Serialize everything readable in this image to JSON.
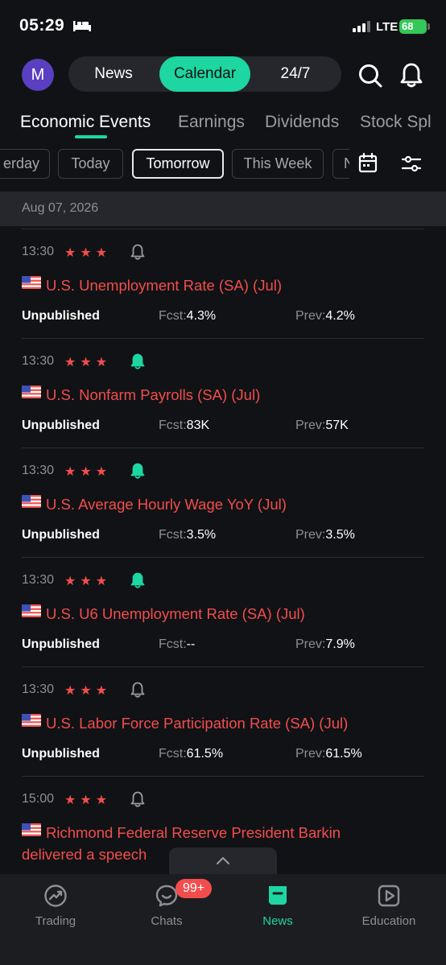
{
  "status_bar": {
    "time": "05:29",
    "network": "LTE",
    "battery": "68"
  },
  "header": {
    "avatar_letter": "M",
    "segments": [
      "News",
      "Calendar",
      "24/7"
    ],
    "active_segment": "Calendar"
  },
  "tabs": [
    "Economic Events",
    "Earnings",
    "Dividends",
    "Stock Spl"
  ],
  "active_tab": "Economic Events",
  "date_chips": [
    "erday",
    "Today",
    "Tomorrow",
    "This Week",
    "N"
  ],
  "active_chip": "Tomorrow",
  "date_header": "Aug 07, 2026",
  "labels": {
    "forecast": "Fcst:",
    "previous": "Prev:"
  },
  "events": [
    {
      "time": "13:30",
      "stars": "★★★",
      "alert": false,
      "title": "U.S. Unemployment Rate (SA) (Jul)",
      "status": "Unpublished",
      "forecast": "4.3%",
      "previous": "4.2%"
    },
    {
      "time": "13:30",
      "stars": "★★★",
      "alert": true,
      "title": "U.S. Nonfarm Payrolls (SA) (Jul)",
      "status": "Unpublished",
      "forecast": "83K",
      "previous": "57K"
    },
    {
      "time": "13:30",
      "stars": "★★★",
      "alert": true,
      "title": "U.S. Average Hourly Wage YoY (Jul)",
      "status": "Unpublished",
      "forecast": "3.5%",
      "previous": "3.5%"
    },
    {
      "time": "13:30",
      "stars": "★★★",
      "alert": true,
      "title": "U.S. U6 Unemployment Rate (SA) (Jul)",
      "status": "Unpublished",
      "forecast": "--",
      "previous": "7.9%"
    },
    {
      "time": "13:30",
      "stars": "★★★",
      "alert": false,
      "title": "U.S. Labor Force Participation Rate (SA) (Jul)",
      "status": "Unpublished",
      "forecast": "61.5%",
      "previous": "61.5%"
    },
    {
      "time": "15:00",
      "stars": "★★★",
      "alert": false,
      "title": "Richmond Federal Reserve President Barkin delivered a speech",
      "status": "",
      "forecast": "",
      "previous": ""
    }
  ],
  "bottom_nav": [
    {
      "label": "Trading",
      "icon": "trading-icon"
    },
    {
      "label": "Chats",
      "icon": "chats-icon"
    },
    {
      "label": "News",
      "icon": "news-icon"
    },
    {
      "label": "Education",
      "icon": "education-icon"
    }
  ],
  "active_nav": "News",
  "chats_badge": "99+",
  "colors": {
    "accent": "#1dd6a1",
    "importance": "#f24d4d",
    "background": "#111215"
  }
}
